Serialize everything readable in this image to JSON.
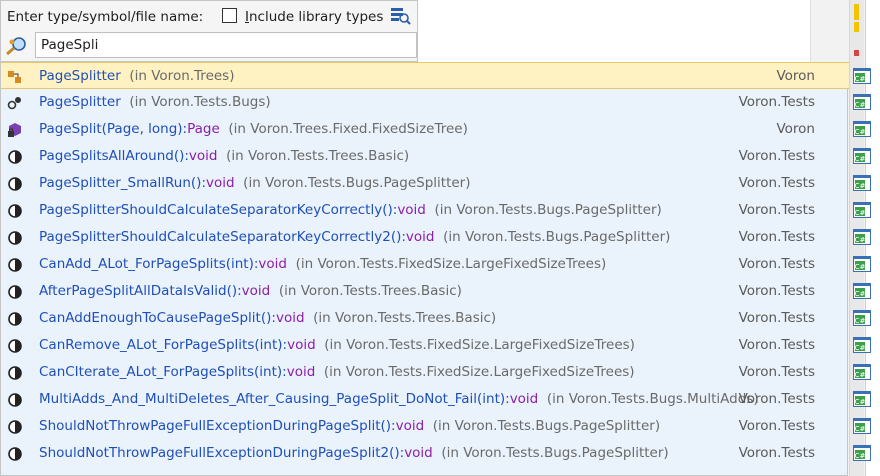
{
  "search": {
    "label": "Enter type/symbol/file name:",
    "include_library_types_accel": "I",
    "include_library_types_rest": "nclude library types",
    "include_library_types_checked": false,
    "query": "PageSpli"
  },
  "results": [
    {
      "kind": "type-icon",
      "pre": "",
      "hl": "PageSplit",
      "post": "ter",
      "sig": "",
      "ret": "",
      "loc": "(in Voron.Trees)",
      "project": "Voron",
      "selected": true
    },
    {
      "kind": "member-icon",
      "pre": "",
      "hl": "PageSplit",
      "post": "ter",
      "sig": "",
      "ret": "",
      "loc": "(in Voron.Tests.Bugs)",
      "project": "Voron.Tests",
      "selected": false
    },
    {
      "kind": "method-private-icon",
      "pre": "",
      "hl": "PageSplit",
      "post": "",
      "sig": "(Page, long):",
      "ret": "Page",
      "loc": "(in Voron.Trees.Fixed.FixedSizeTree)",
      "project": "Voron",
      "selected": false
    },
    {
      "kind": "method-icon",
      "pre": "",
      "hl": "PageSplit",
      "post": "sAllAround",
      "sig": "():",
      "ret": "void",
      "loc": "(in Voron.Tests.Trees.Basic)",
      "project": "Voron.Tests",
      "selected": false
    },
    {
      "kind": "method-icon",
      "pre": "",
      "hl": "PageSplit",
      "post": "ter_SmallRun",
      "sig": "():",
      "ret": "void",
      "loc": "(in Voron.Tests.Bugs.PageSplitter)",
      "project": "Voron.Tests",
      "selected": false
    },
    {
      "kind": "method-icon",
      "pre": "",
      "hl": "PageSplit",
      "post": "terShouldCalculateSeparatorKeyCorrectly",
      "sig": "():",
      "ret": "void",
      "loc": "(in Voron.Tests.Bugs.PageSplitter)",
      "project": "Voron.Tests",
      "selected": false
    },
    {
      "kind": "method-icon",
      "pre": "",
      "hl": "PageSplit",
      "post": "terShouldCalculateSeparatorKeyCorrectly2",
      "sig": "():",
      "ret": "void",
      "loc": "(in Voron.Tests.Bugs.PageSplitter)",
      "project": "Voron.Tests",
      "selected": false
    },
    {
      "kind": "method-icon",
      "pre": "CanAdd_ALot_For",
      "hl": "PageSplit",
      "post": "s",
      "sig": "(int):",
      "ret": "void",
      "loc": "(in Voron.Tests.FixedSize.LargeFixedSizeTrees)",
      "project": "Voron.Tests",
      "selected": false
    },
    {
      "kind": "method-icon",
      "pre": "After",
      "hl": "PageSplit",
      "post": "AllDataIsValid",
      "sig": "():",
      "ret": "void",
      "loc": "(in Voron.Tests.Trees.Basic)",
      "project": "Voron.Tests",
      "selected": false
    },
    {
      "kind": "method-icon",
      "pre": "CanAddEnoughToCause",
      "hl": "PageSplit",
      "post": "",
      "sig": "():",
      "ret": "void",
      "loc": "(in Voron.Tests.Trees.Basic)",
      "project": "Voron.Tests",
      "selected": false
    },
    {
      "kind": "method-icon",
      "pre": "CanRemove_ALot_For",
      "hl": "PageSplit",
      "post": "s",
      "sig": "(int):",
      "ret": "void",
      "loc": "(in Voron.Tests.FixedSize.LargeFixedSizeTrees)",
      "project": "Voron.Tests",
      "selected": false
    },
    {
      "kind": "method-icon",
      "pre": "CanCIterate_ALot_For",
      "hl": "PageSplit",
      "post": "s",
      "sig": "(int):",
      "ret": "void",
      "loc": "(in Voron.Tests.FixedSize.LargeFixedSizeTrees)",
      "project": "Voron.Tests",
      "selected": false
    },
    {
      "kind": "method-icon",
      "pre": "MultiAdds_And_MultiDeletes_After_Causing_",
      "hl": "PageSplit",
      "post": "_DoNot_Fail",
      "sig": "(int):",
      "ret": "void",
      "loc": "(in Voron.Tests.Bugs.MultiAdds)",
      "project": "Voron.Tests",
      "selected": false
    },
    {
      "kind": "method-icon",
      "pre": "ShouldNotThrow",
      "hl": "Page",
      "post": "FullExceptionDuring",
      "hl2": "PageSplit",
      "post2": "",
      "sig": "():",
      "ret": "void",
      "loc": "(in Voron.Tests.Bugs.PageSplitter)",
      "project": "Voron.Tests",
      "selected": false
    },
    {
      "kind": "method-icon",
      "pre": "ShouldNotThrow",
      "hl": "Page",
      "post": "FullExceptionDuring",
      "hl2": "PageSplit",
      "post2": "2",
      "sig": "():",
      "ret": "void",
      "loc": "(in Voron.Tests.Bugs.PageSplitter)",
      "project": "Voron.Tests",
      "selected": false
    }
  ],
  "colors": {
    "accent_method": "#1f4fb8",
    "type_purple": "#8b1fa8",
    "selection": "#fff2c2",
    "list_bg": "#eaf2fb"
  }
}
